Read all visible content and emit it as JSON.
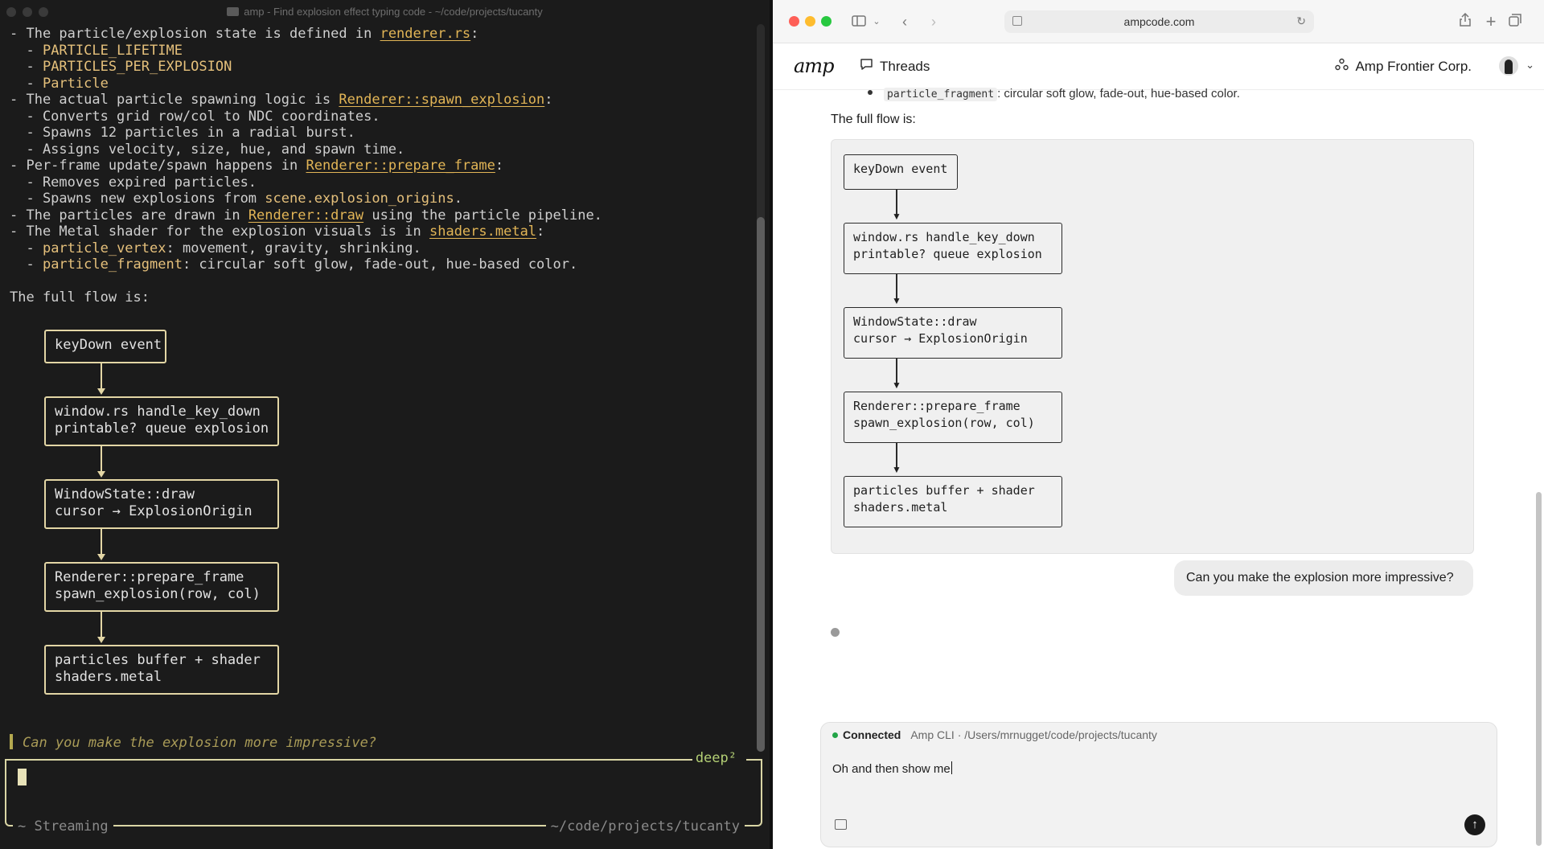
{
  "terminal": {
    "title": "amp - Find explosion effect typing code - ~/code/projects/tucanty",
    "lines": [
      [
        {
          "t": "- The particle/explosion state is defined in "
        },
        {
          "t": "renderer.rs",
          "c": "ul"
        },
        {
          "t": ":"
        }
      ],
      [
        {
          "t": "  - "
        },
        {
          "t": "PARTICLE_LIFETIME",
          "c": "yl"
        }
      ],
      [
        {
          "t": "  - "
        },
        {
          "t": "PARTICLES_PER_EXPLOSION",
          "c": "yl"
        }
      ],
      [
        {
          "t": "  - "
        },
        {
          "t": "Particle",
          "c": "yl"
        }
      ],
      [
        {
          "t": "- The actual particle spawning logic is "
        },
        {
          "t": "Renderer::spawn_explosion",
          "c": "ul"
        },
        {
          "t": ":"
        }
      ],
      [
        {
          "t": "  - Converts grid row/col to NDC coordinates."
        }
      ],
      [
        {
          "t": "  - Spawns 12 particles in a radial burst."
        }
      ],
      [
        {
          "t": "  - Assigns velocity, size, hue, and spawn time."
        }
      ],
      [
        {
          "t": "- Per-frame update/spawn happens in "
        },
        {
          "t": "Renderer::prepare_frame",
          "c": "ul"
        },
        {
          "t": ":"
        }
      ],
      [
        {
          "t": "  - Removes expired particles."
        }
      ],
      [
        {
          "t": "  - Spawns new explosions from "
        },
        {
          "t": "scene.explosion_origins",
          "c": "yl"
        },
        {
          "t": "."
        }
      ],
      [
        {
          "t": "- The particles are drawn in "
        },
        {
          "t": "Renderer::draw",
          "c": "ul"
        },
        {
          "t": " using the particle pipeline."
        }
      ],
      [
        {
          "t": "- The Metal shader for the explosion visuals is in "
        },
        {
          "t": "shaders.metal",
          "c": "ul"
        },
        {
          "t": ":"
        }
      ],
      [
        {
          "t": "  - "
        },
        {
          "t": "particle_vertex",
          "c": "yl"
        },
        {
          "t": ": movement, gravity, shrinking."
        }
      ],
      [
        {
          "t": "  - "
        },
        {
          "t": "particle_fragment",
          "c": "yl"
        },
        {
          "t": ": circular soft glow, fade-out, hue-based color."
        }
      ],
      [
        {
          "t": ""
        }
      ],
      [
        {
          "t": "The full flow is:"
        }
      ]
    ],
    "flow": [
      "keyDown event",
      "window.rs handle_key_down\nprintable? queue explosion",
      "WindowState::draw\ncursor → ExplosionOrigin",
      "Renderer::prepare_frame\nspawn_explosion(row, col)",
      "particles buffer + shader\nshaders.metal"
    ],
    "prompt": "Can you make the explosion more impressive?",
    "mode_label": "deep²",
    "status_left": "~ Streaming",
    "status_right": "~/code/projects/tucanty"
  },
  "browser": {
    "url": "ampcode.com",
    "logo": "amp",
    "threads_label": "Threads",
    "org_label": "Amp Frontier Corp.",
    "bullet_code": "particle_fragment",
    "bullet_text": ": circular soft glow, fade-out, hue-based color.",
    "flow_heading": "The full flow is:",
    "flow": [
      "keyDown event",
      "window.rs handle_key_down\nprintable? queue explosion",
      "WindowState::draw\ncursor → ExplosionOrigin",
      "Renderer::prepare_frame\nspawn_explosion(row, col)",
      "particles buffer + shader\nshaders.metal"
    ],
    "user_message": "Can you make the explosion more impressive?",
    "connection": {
      "status": "Connected",
      "detail": "Amp CLI · /Users/mrnugget/code/projects/tucanty"
    },
    "composer_value": "Oh and then show me"
  },
  "colors": {
    "terminal_bg": "#1b1b1b",
    "terminal_accent": "#e5c07b",
    "connected_green": "#22a447",
    "bubble_bg": "#ececec"
  },
  "icons": {
    "sidebar_toggle": "sidebar-icon",
    "back": "chevron-left-icon",
    "forward": "chevron-right-icon",
    "share": "share-icon",
    "new_tab": "plus-icon",
    "tabs": "tabs-icon",
    "threads": "chat-bubble-icon",
    "org": "org-icon",
    "attach": "image-icon",
    "send": "arrow-up-icon"
  }
}
